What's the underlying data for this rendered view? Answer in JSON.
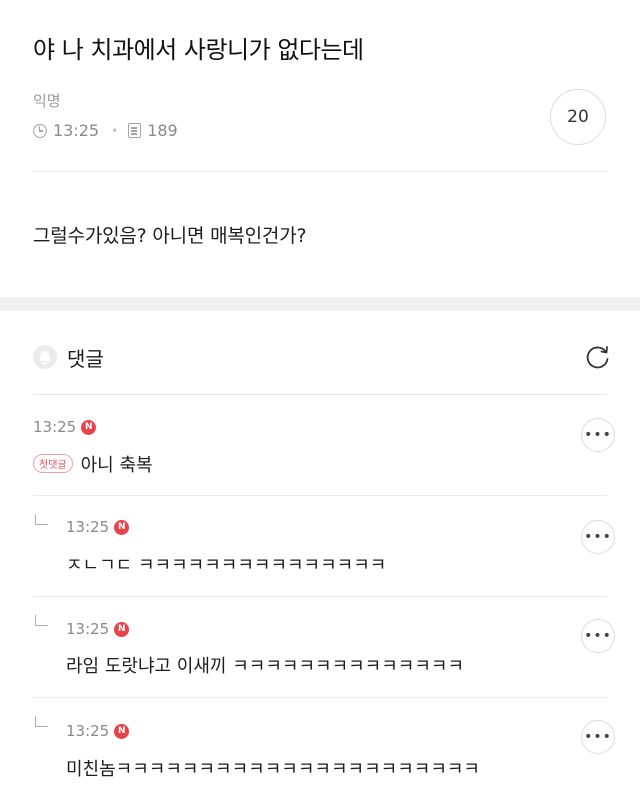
{
  "post": {
    "title": "야 나 치과에서 사랑니가 없다는데",
    "author": "익명",
    "time": "13:25",
    "views": "189",
    "comment_count": "20",
    "body": "그럴수가있음? 아니면 매복인건가?"
  },
  "comments_section": {
    "title": "댓글"
  },
  "comments": [
    {
      "time": "13:25",
      "new_badge": "N",
      "first_badge": "첫댓글",
      "text": "아니 축복",
      "reply": false
    },
    {
      "time": "13:25",
      "new_badge": "N",
      "text": "ㅈㄴㄱㄷ ㅋㅋㅋㅋㅋㅋㅋㅋㅋㅋㅋㅋㅋㅋㅋ",
      "reply": true
    },
    {
      "time": "13:25",
      "new_badge": "N",
      "text": "라임 도랏냐고 이새끼 ㅋㅋㅋㅋㅋㅋㅋㅋㅋㅋㅋㅋㅋㅋ",
      "reply": true
    },
    {
      "time": "13:25",
      "new_badge": "N",
      "text": "미친놈ㅋㅋㅋㅋㅋㅋㅋㅋㅋㅋㅋㅋㅋㅋㅋㅋㅋㅋㅋㅋㅋㅋ",
      "reply": true
    }
  ],
  "icons": {
    "clock": "clock-icon",
    "views": "document-icon",
    "bell": "bell-icon",
    "refresh": "refresh-icon",
    "more": "more-icon"
  },
  "colors": {
    "new_badge": "#e8434a",
    "first_badge": "#e3525a"
  }
}
